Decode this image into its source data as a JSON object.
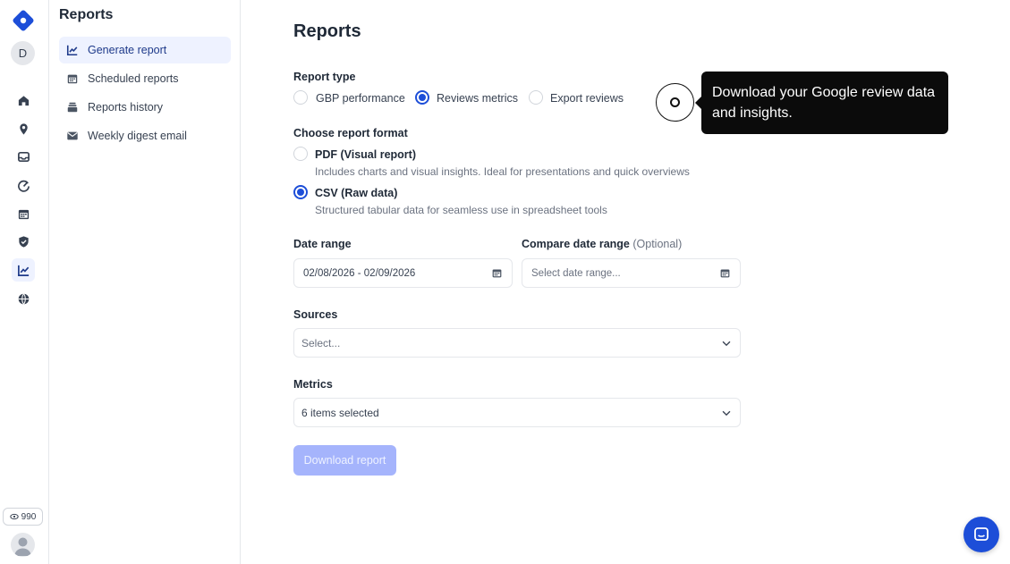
{
  "rail": {
    "avatar_initial": "D",
    "credits": "990",
    "icons": [
      "home-icon",
      "location-pin-icon",
      "inbox-icon",
      "gauge-icon",
      "calendar-icon",
      "shield-icon",
      "chart-icon",
      "globe-icon"
    ]
  },
  "sidebar": {
    "title": "Reports",
    "items": [
      {
        "label": "Generate report",
        "icon": "line-chart-icon",
        "active": true
      },
      {
        "label": "Scheduled reports",
        "icon": "calendar-icon"
      },
      {
        "label": "Reports history",
        "icon": "stack-icon"
      },
      {
        "label": "Weekly digest email",
        "icon": "mail-icon"
      }
    ]
  },
  "main": {
    "title": "Reports",
    "report_type": {
      "label": "Report type",
      "options": [
        "GBP performance",
        "Reviews metrics",
        "Export reviews"
      ],
      "selected": "Reviews metrics"
    },
    "format": {
      "label": "Choose report format",
      "options": [
        {
          "title": "PDF (Visual report)",
          "desc": "Includes charts and visual insights. Ideal for presentations and quick overviews"
        },
        {
          "title": "CSV (Raw data)",
          "desc": "Structured tabular data for seamless use in spreadsheet tools"
        }
      ],
      "selected": "CSV (Raw data)"
    },
    "date_range": {
      "label": "Date range",
      "value": "02/08/2026 - 02/09/2026"
    },
    "compare_range": {
      "label": "Compare date range",
      "optional": "(Optional)",
      "placeholder": "Select date range..."
    },
    "sources": {
      "label": "Sources",
      "placeholder": "Select..."
    },
    "metrics": {
      "label": "Metrics",
      "value": "6 items selected"
    },
    "download_label": "Download report"
  },
  "tooltip": {
    "text": "Download your Google review data and insights."
  },
  "colors": {
    "accent": "#1d4ed8",
    "disabled_button": "#a5b4fc",
    "active_nav_bg": "#eef2ff"
  }
}
